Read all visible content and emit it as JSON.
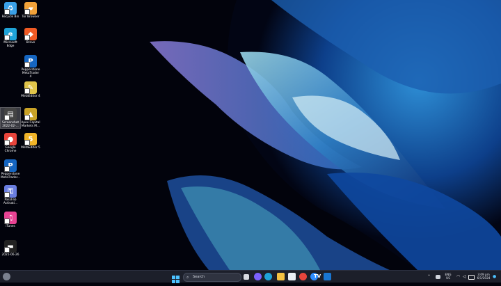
{
  "desktop_icons": [
    {
      "id": "recycle-bin",
      "label": "Recycle Bin",
      "color": "#3aa0e8",
      "glyph": "♻"
    },
    {
      "id": "tor-browser",
      "label": "Tor Browser",
      "color": "#f2a23a",
      "glyph": "▰"
    },
    {
      "id": "microsoft-edge",
      "label": "Microsoft Edge",
      "color": "#1fa3d8",
      "glyph": "e"
    },
    {
      "id": "brave",
      "label": "Brave",
      "color": "#f05a24",
      "glyph": "◆"
    },
    {
      "id": "pepperstone-mt4",
      "label": "Pepperstone MetaTrader 4",
      "color": "#1565c0",
      "glyph": "P"
    },
    {
      "id": "metaeditor-4",
      "label": "MetaEditor 4",
      "color": "#e0c44a",
      "glyph": "✎"
    },
    {
      "id": "screenshot",
      "label": "Screenshot 2022-02-...",
      "color": "#444",
      "glyph": "▤"
    },
    {
      "id": "apex-capital",
      "label": "Apex Capital Markets M...",
      "color": "#c9a227",
      "glyph": "▲"
    },
    {
      "id": "google-chrome",
      "label": "Google Chrome",
      "color": "#e8453c",
      "glyph": "●"
    },
    {
      "id": "metaeditor-5",
      "label": "MetaEditor 5",
      "color": "#f0b429",
      "glyph": "5"
    },
    {
      "id": "pepperstone-mt5",
      "label": "Pepperstone MetaTrader...",
      "color": "#1565c0",
      "glyph": "P"
    },
    {
      "id": "passfab",
      "label": "PassFab Activati...",
      "color": "#6a7ee0",
      "glyph": "⚿"
    },
    {
      "id": "itunes",
      "label": "iTunes",
      "color": "#e84393",
      "glyph": "♫"
    },
    {
      "id": "folder-2021",
      "label": "2021-06-26",
      "color": "#222",
      "glyph": "▬"
    }
  ],
  "taskbar": {
    "search_placeholder": "Search",
    "tray": {
      "language": "ENG",
      "region": "US",
      "time": "3:09 pm",
      "date": "6/1/2024"
    }
  }
}
